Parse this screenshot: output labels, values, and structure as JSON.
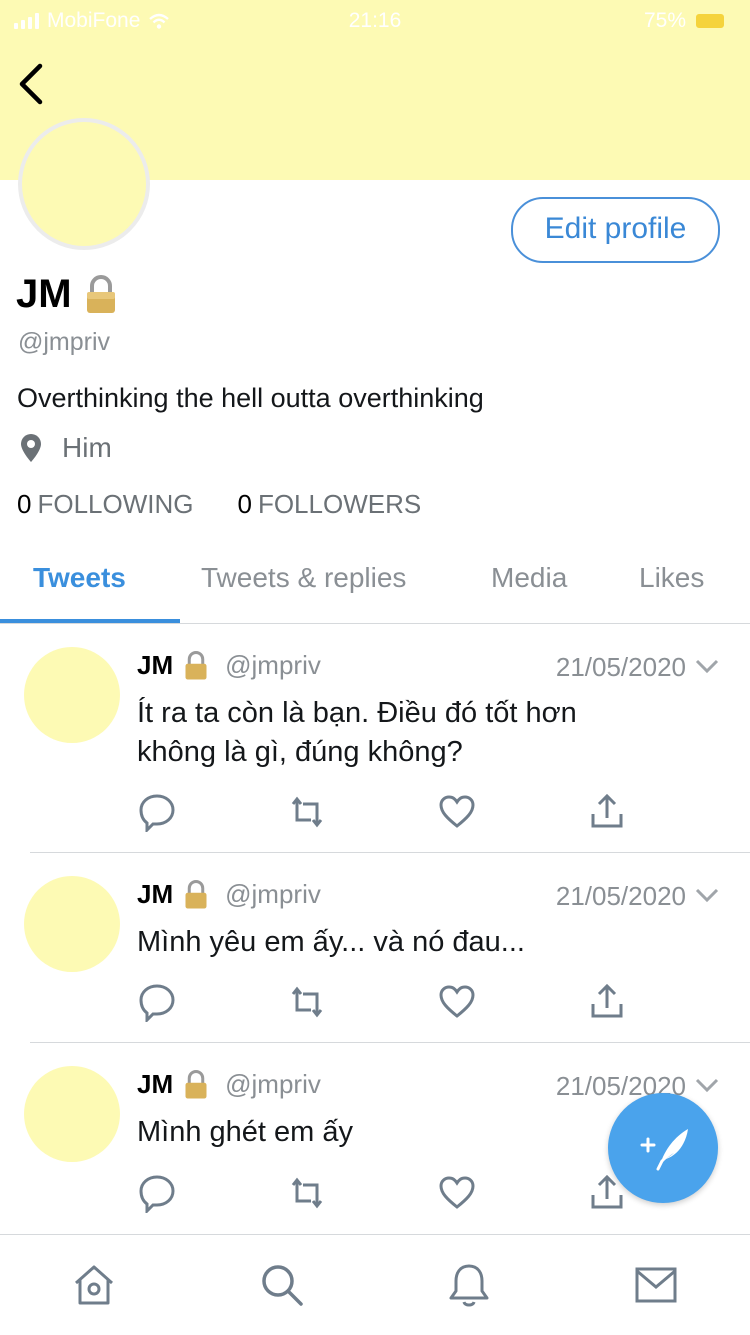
{
  "status_bar": {
    "carrier": "MobiFone",
    "time": "21:16",
    "battery": "75%"
  },
  "profile": {
    "name": "JM",
    "handle": "@jmpriv",
    "bio": "Overthinking the hell outta overthinking",
    "location": "Him",
    "following_count": "0",
    "following_label": "FOLLOWING",
    "followers_count": "0",
    "followers_label": "FOLLOWERS",
    "edit_label": "Edit profile",
    "banner_color": "#fdfab4",
    "accent_color": "#3a8fdd"
  },
  "tabs": [
    {
      "label": "Tweets",
      "active": true
    },
    {
      "label": "Tweets & replies",
      "active": false
    },
    {
      "label": "Media",
      "active": false
    },
    {
      "label": "Likes",
      "active": false
    }
  ],
  "tweets": [
    {
      "name": "JM",
      "handle": "@jmpriv",
      "date": "21/05/2020",
      "text_line1": "Ít ra ta còn là bạn. Điều đó tốt hơn",
      "text_line2": "không là gì, đúng không?"
    },
    {
      "name": "JM",
      "handle": "@jmpriv",
      "date": "21/05/2020",
      "text_line1": "Mình yêu em ấy... và nó đau...",
      "text_line2": ""
    },
    {
      "name": "JM",
      "handle": "@jmpriv",
      "date": "21/05/2020",
      "text_line1": "Mình ghét em ấy",
      "text_line2": ""
    }
  ],
  "icons": {
    "back": "chevron-left-icon",
    "lock": "lock-icon",
    "location": "location-pin-icon",
    "reply": "reply-icon",
    "retweet": "retweet-icon",
    "like": "heart-icon",
    "share": "share-icon",
    "compose": "compose-tweet-icon",
    "nav": [
      "home-icon",
      "search-icon",
      "notifications-icon",
      "messages-icon"
    ]
  }
}
